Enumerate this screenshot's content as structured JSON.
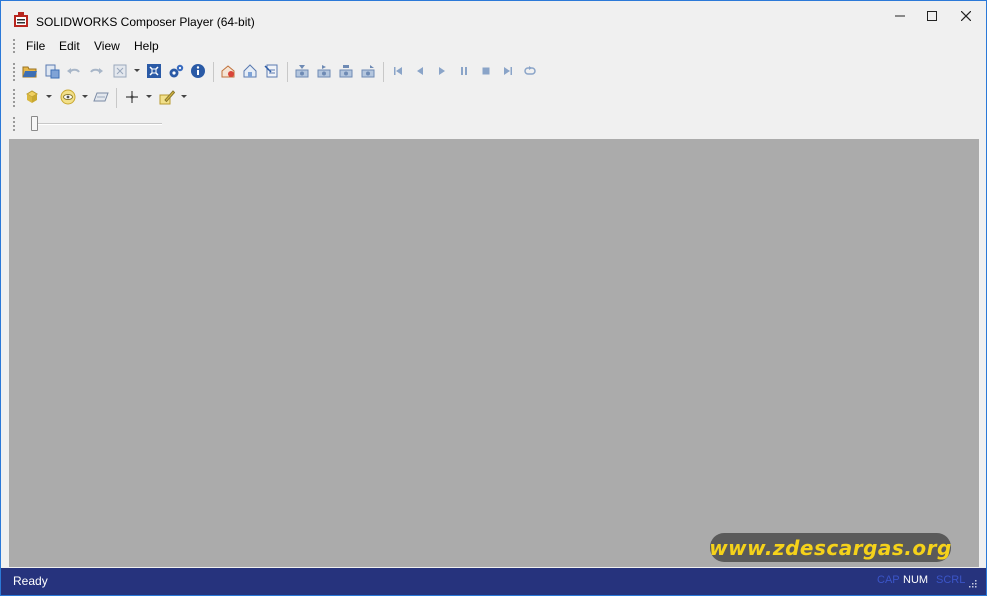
{
  "window": {
    "title": "SOLIDWORKS Composer Player (64-bit)"
  },
  "menu": {
    "file": "File",
    "edit": "Edit",
    "view": "View",
    "help": "Help"
  },
  "toolbar1": {
    "icons": [
      "open-icon",
      "import-icon",
      "undo-icon",
      "redo-icon",
      "zoom-fit-icon",
      "fullscreen-icon",
      "settings-icon",
      "info-icon",
      "home-view-icon",
      "reset-view-icon",
      "collaboration-icon",
      "play-prev-keyframe-icon",
      "play-next-keyframe-icon",
      "play-start-icon",
      "play-end-icon",
      "first-icon",
      "previous-icon",
      "play-icon",
      "pause-icon",
      "stop-icon",
      "last-icon",
      "loop-icon"
    ]
  },
  "toolbar2": {
    "icons": [
      "render-mode-icon",
      "visibility-icon",
      "plane-icon",
      "measure-icon",
      "annotation-icon"
    ]
  },
  "status": {
    "text": "Ready",
    "cap": "CAP",
    "num": "NUM",
    "scrl": "SCRL"
  },
  "watermark": {
    "text": "www.zdescargas.org"
  },
  "colors": {
    "viewport": "#ababab",
    "statusbar": "#26337d",
    "accent": "#2b79d8"
  }
}
